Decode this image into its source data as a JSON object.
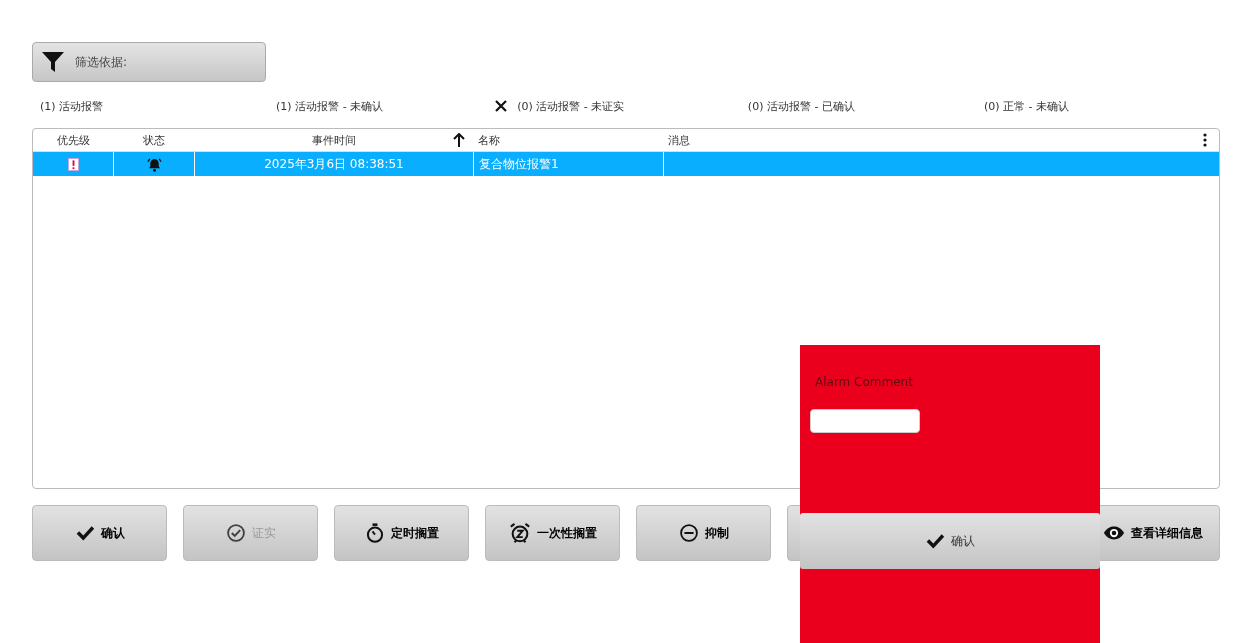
{
  "filter_button": {
    "label": "筛选依据:"
  },
  "filters": [
    {
      "label": "(1) 活动报警",
      "cleared": false
    },
    {
      "label": "(1) 活动报警 - 未确认",
      "cleared": false
    },
    {
      "label": "(0) 活动报警 - 未证实",
      "cleared": true
    },
    {
      "label": "(0) 活动报警 - 已确认",
      "cleared": false
    },
    {
      "label": "(0) 正常 - 未确认",
      "cleared": false
    }
  ],
  "table": {
    "columns": [
      {
        "label": "优先级",
        "sorted": false
      },
      {
        "label": "状态",
        "sorted": false
      },
      {
        "label": "事件时间",
        "sorted": true
      },
      {
        "label": "名称",
        "sorted": false
      },
      {
        "label": "消息",
        "sorted": false
      }
    ],
    "rows": [
      {
        "selected": true,
        "event_time": "2025年3月6日 08:38:51",
        "name": "复合物位报警1"
      }
    ]
  },
  "actions": [
    {
      "kind": "acknowledge",
      "label": "确认",
      "disabled": false
    },
    {
      "kind": "confirm",
      "label": "证实",
      "disabled": true
    },
    {
      "kind": "timed",
      "label": "定时搁置",
      "disabled": false
    },
    {
      "kind": "once",
      "label": "一次性搁置",
      "disabled": false
    },
    {
      "kind": "suppress",
      "label": "抑制",
      "disabled": false
    },
    {
      "kind": "covered"
    },
    {
      "kind": "details",
      "label": "查看详细信息",
      "disabled": false
    }
  ],
  "popup": {
    "title": "Alarm Comment",
    "button": {
      "label": "确认"
    }
  }
}
